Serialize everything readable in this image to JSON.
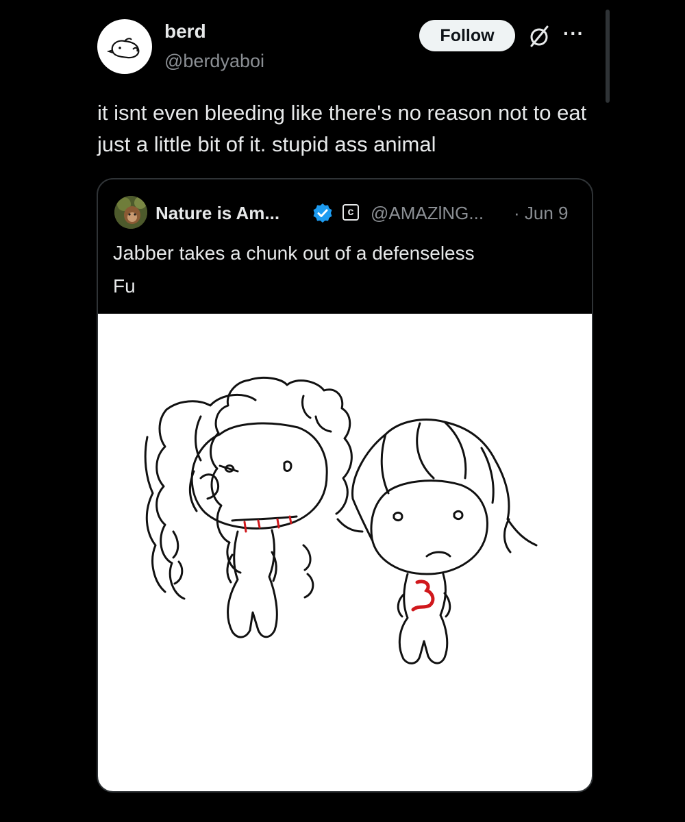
{
  "post": {
    "display_name": "berd",
    "handle": "@berdyaboi",
    "follow_label": "Follow",
    "text": "it isnt even bleeding like there's no reason not to eat just a little bit of it. stupid ass animal"
  },
  "quote": {
    "name": "Nature is Am...",
    "handle": "@AMAZlNG...",
    "date": "· Jun 9",
    "copyright_mark": "c",
    "text_word": "Jabber",
    "text_rest": " takes a chunk out of a defenseless",
    "text_line2": "Fu"
  },
  "icons": {
    "more": "more-options-icon",
    "grok": "grok-slash-icon",
    "verified": "verified-badge-icon"
  },
  "colors": {
    "background": "#000000",
    "text": "#e7e9ea",
    "muted": "#8b8f94",
    "border": "#2f3336",
    "verified": "#1d9bf0",
    "follow_bg": "#eff3f4",
    "blood": "#d0181c"
  }
}
